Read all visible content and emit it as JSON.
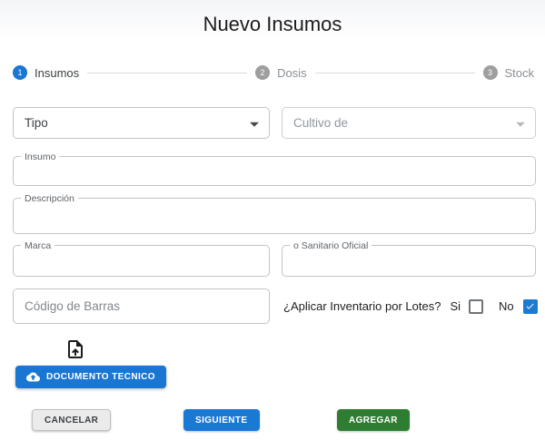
{
  "window": {
    "title": "Nuevo Insumos"
  },
  "stepper": {
    "steps": [
      {
        "number": "1",
        "label": "Insumos",
        "state": "active"
      },
      {
        "number": "2",
        "label": "Dosis",
        "state": "inactive"
      },
      {
        "number": "3",
        "label": "Stock",
        "state": "inactive"
      }
    ]
  },
  "form": {
    "tipo_select": {
      "value": "Tipo"
    },
    "cultivo_select": {
      "value": "Cultivo de",
      "disabled": true
    },
    "insumo_field": {
      "label": "Insumo",
      "value": ""
    },
    "descripcion_field": {
      "label": "Descripción",
      "value": ""
    },
    "marca_field": {
      "label": "Marca",
      "value": ""
    },
    "sanitario_field": {
      "label": "o Sanitario Oficial",
      "value": ""
    },
    "codigo_barras_field": {
      "placeholder": "Código de Barras",
      "value": ""
    },
    "inventario_lotes": {
      "question": "¿Aplicar Inventario por Lotes?",
      "options": [
        {
          "label": "Si",
          "checked": false
        },
        {
          "label": "No",
          "checked": true
        }
      ]
    }
  },
  "upload": {
    "icon": "upload-file-icon",
    "button_icon": "cloud-upload-icon",
    "button_label": "DOCUMENTO TECNICO"
  },
  "actions": {
    "cancel_label": "CANCELAR",
    "next_label": "SIGUIENTE",
    "add_label": "AGREGAR"
  },
  "colors": {
    "primary_blue": "#1976d2",
    "success_green": "#2e7d32",
    "inactive_gray": "#9e9e9e",
    "border_gray": "#c4c4c4",
    "cancel_gray": "#ebebeb",
    "checkbox_blue": "#1c7ad1"
  }
}
